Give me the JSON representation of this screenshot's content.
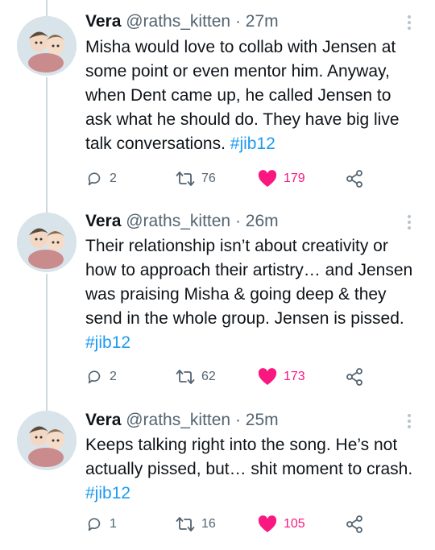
{
  "tweets": [
    {
      "name": "Vera",
      "handle": "@raths_kitten",
      "time": "· 27m",
      "text": "Misha would love to collab with Jensen at some point or even mentor him. Anyway, when Dent came up, he called Jensen to ask what he should do. They have big live talk conversations. ",
      "hashtag": "#jib12",
      "replies": "2",
      "retweets": "76",
      "likes": "179"
    },
    {
      "name": "Vera",
      "handle": "@raths_kitten",
      "time": "· 26m",
      "text": "Their relationship isn’t about creativity or how to approach their artistry… and Jensen was praising Misha & going deep & they send in the whole group. Jensen is pissed. ",
      "hashtag": "#jib12",
      "replies": "2",
      "retweets": "62",
      "likes": "173"
    },
    {
      "name": "Vera",
      "handle": "@raths_kitten",
      "time": "· 25m",
      "text": "Keeps talking right into the song. He’s not actually pissed, but… shit moment to crash. ",
      "hashtag": "#jib12",
      "replies": "1",
      "retweets": "16",
      "likes": "105"
    }
  ],
  "icons": {
    "reply": "reply-icon",
    "retweet": "retweet-icon",
    "like": "heart-icon",
    "share": "share-icon",
    "more": "more-icon"
  },
  "colors": {
    "hashtag": "#1d9bf0",
    "like": "#f91880",
    "muted": "#536471"
  }
}
